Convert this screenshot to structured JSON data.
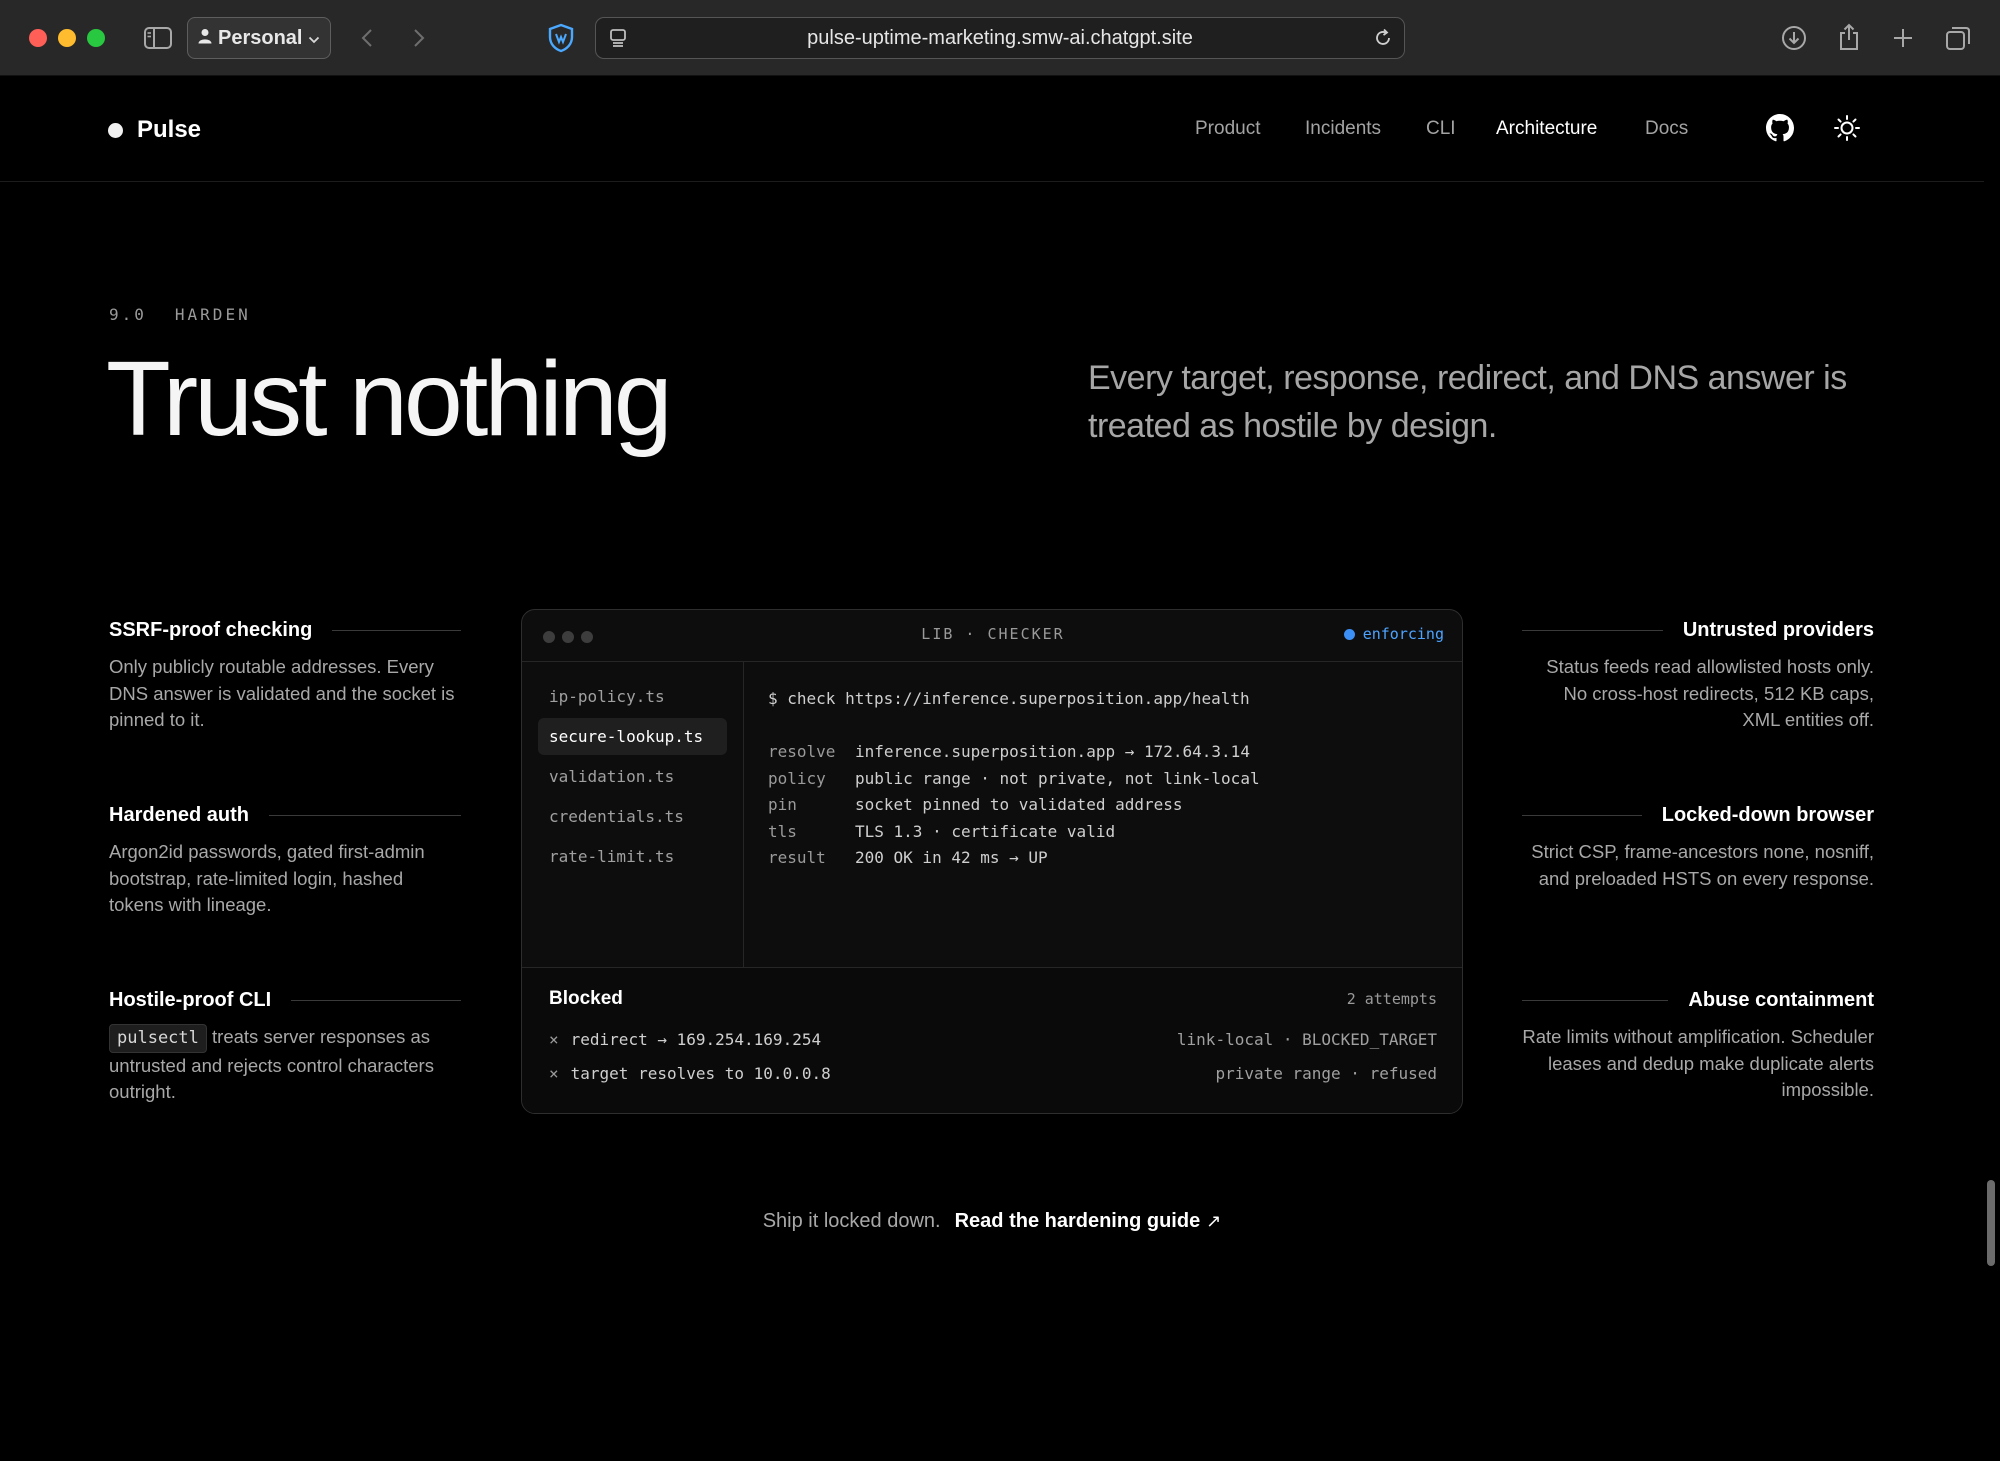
{
  "browser": {
    "profile_label": "Personal",
    "url": "pulse-uptime-marketing.smw-ai.chatgpt.site"
  },
  "site": {
    "brand": "Pulse",
    "nav": [
      {
        "label": "Product"
      },
      {
        "label": "Incidents"
      },
      {
        "label": "CLI"
      },
      {
        "label": "Architecture",
        "active": true
      },
      {
        "label": "Docs"
      }
    ]
  },
  "section": {
    "number": "9.0",
    "eyebrow": "HARDEN",
    "title": "Trust nothing",
    "subtitle": "Every target, response, redirect, and DNS answer is treated as hostile by design."
  },
  "features_left": [
    {
      "title": "SSRF-proof checking",
      "body": "Only publicly routable addresses. Every DNS answer is validated and the socket is pinned to it."
    },
    {
      "title": "Hardened auth",
      "body": "Argon2id passwords, gated first-admin bootstrap, rate-limited login, hashed tokens with lineage."
    },
    {
      "title": "Hostile-proof CLI",
      "code": "pulsectl",
      "body": "treats server responses as untrusted and rejects control characters outright."
    }
  ],
  "features_right": [
    {
      "title": "Untrusted providers",
      "body": "Status feeds read allowlisted hosts only. No cross-host redirects, 512 KB caps, XML entities off."
    },
    {
      "title": "Locked-down browser",
      "body": "Strict CSP, frame-ancestors none, nosniff, and preloaded HSTS on every response."
    },
    {
      "title": "Abuse containment",
      "body": "Rate limits without amplification. Scheduler leases and dedup make duplicate alerts impossible."
    }
  ],
  "terminal": {
    "label": "LIB · CHECKER",
    "status": "enforcing",
    "files": [
      {
        "name": "ip-policy.ts"
      },
      {
        "name": "secure-lookup.ts",
        "active": true
      },
      {
        "name": "validation.ts"
      },
      {
        "name": "credentials.ts"
      },
      {
        "name": "rate-limit.ts"
      }
    ],
    "command": "$ check https://inference.superposition.app/health",
    "rows": [
      {
        "key": "resolve",
        "value": "inference.superposition.app → 172.64.3.14"
      },
      {
        "key": "policy",
        "value": "public range · not private, not link-local"
      },
      {
        "key": "pin",
        "value": "socket pinned to validated address"
      },
      {
        "key": "tls",
        "value": "TLS 1.3 · certificate valid"
      },
      {
        "key": "result",
        "value": "200 OK in 42 ms → UP"
      }
    ],
    "blocked": {
      "title": "Blocked",
      "count": "2 attempts",
      "items": [
        {
          "mark": "×",
          "text": "redirect → 169.254.169.254",
          "reason": "link-local · BLOCKED_TARGET"
        },
        {
          "mark": "×",
          "text": "target resolves to 10.0.0.8",
          "reason": "private range · refused"
        }
      ]
    }
  },
  "cta": {
    "lead": "Ship it locked down.",
    "link": "Read the hardening guide",
    "arrow": "↗"
  }
}
